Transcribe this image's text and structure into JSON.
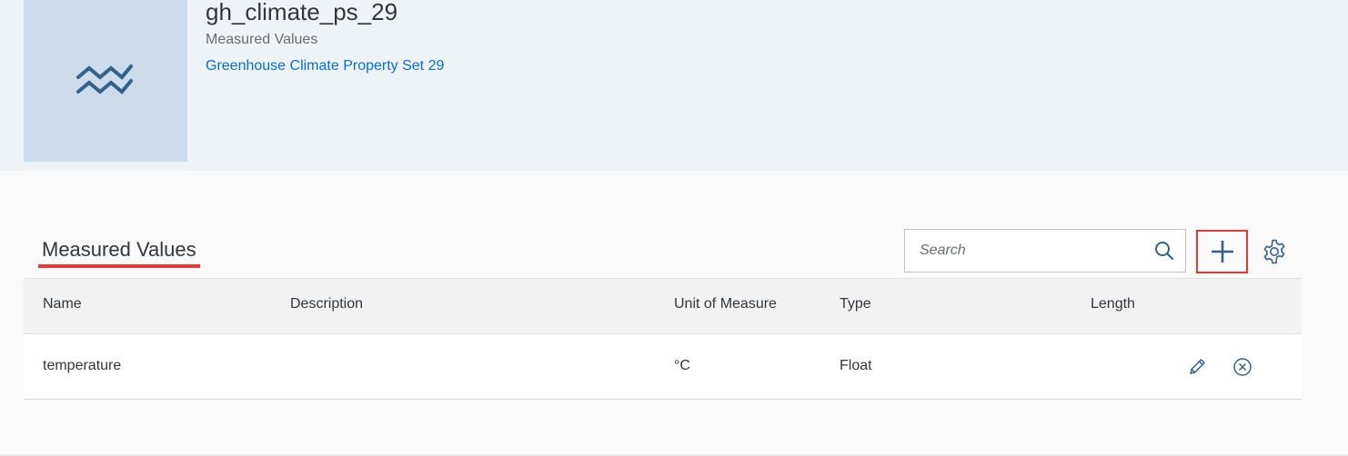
{
  "header": {
    "title": "gh_climate_ps_29",
    "subtitle": "Measured Values",
    "link": "Greenhouse Climate Property Set 29",
    "thumbnail_icon": "measured-values-wave-icon"
  },
  "section": {
    "title": "Measured Values"
  },
  "toolbar": {
    "search_placeholder": "Search",
    "search_value": "",
    "add_icon": "plus-icon",
    "settings_icon": "gear-icon"
  },
  "table": {
    "columns": [
      "Name",
      "Description",
      "Unit of Measure",
      "Type",
      "Length"
    ],
    "rows": [
      {
        "name": "temperature",
        "description": "",
        "unit": "°C",
        "type": "Float",
        "length": ""
      }
    ],
    "row_actions": [
      "edit-icon",
      "delete-icon"
    ]
  },
  "colors": {
    "accent": "#0a6ed1",
    "icon": "#346187",
    "highlight": "#e53935",
    "header_bg": "#eef3f8",
    "thumb_bg": "#ccdcec"
  }
}
